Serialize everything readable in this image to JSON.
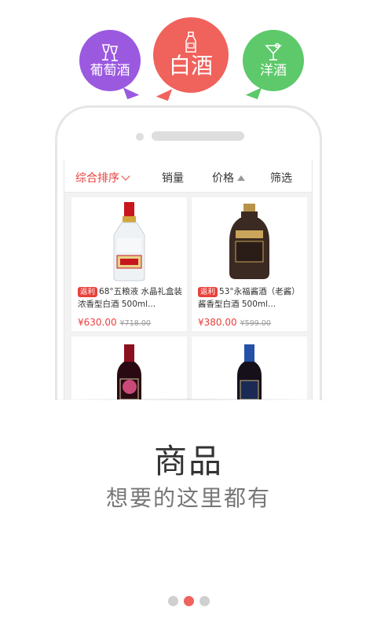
{
  "categories": [
    {
      "label": "葡萄酒",
      "icon": "wine-glasses-icon",
      "color": "#9b59e0"
    },
    {
      "label": "白酒",
      "icon": "baijiu-bottle-icon",
      "color": "#f0625c"
    },
    {
      "label": "洋酒",
      "icon": "cocktail-glass-icon",
      "color": "#5dc96a"
    }
  ],
  "sort_bar": {
    "comprehensive": "综合排序",
    "sales": "销量",
    "price": "价格",
    "filter": "筛选"
  },
  "products": [
    {
      "tag": "返利",
      "title": "68°五粮液 水晶礼盒装 浓香型白酒 500ml...",
      "price": "¥630.00",
      "original_price": "¥718.00"
    },
    {
      "tag": "返利",
      "title": "53°永福酱酒（老酱）酱香型白酒 500ml...",
      "price": "¥380.00",
      "original_price": "¥599.00"
    },
    {
      "tag": "",
      "title": "",
      "price": "",
      "original_price": ""
    },
    {
      "tag": "",
      "title": "",
      "price": "",
      "original_price": ""
    }
  ],
  "headline": "商品",
  "subline": "想要的这里都有",
  "pager": {
    "count": 3,
    "active_index": 1
  },
  "colors": {
    "accent": "#f0625c",
    "price_red": "#e8413c"
  }
}
